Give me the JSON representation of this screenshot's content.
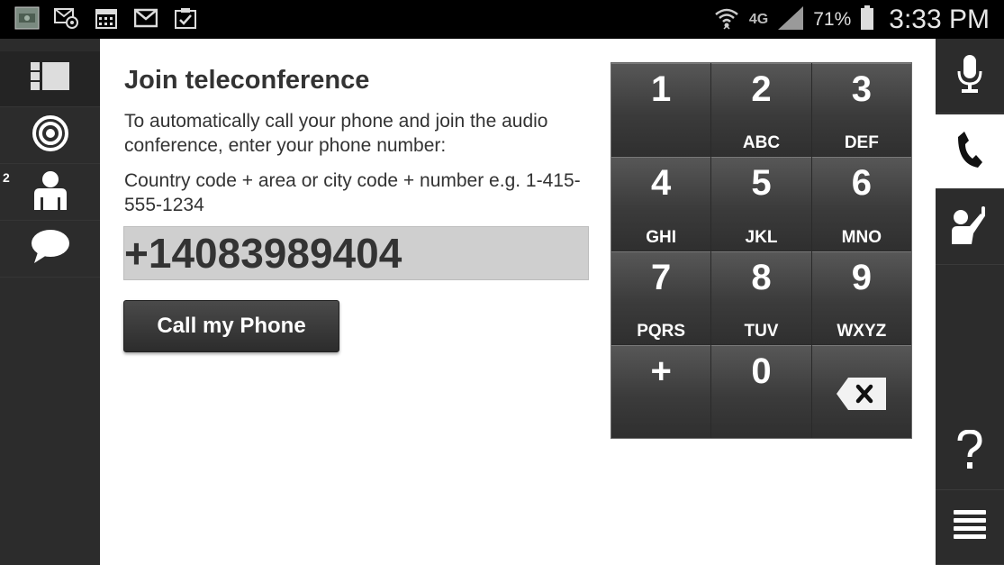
{
  "status_bar": {
    "left_icons": [
      "app-icon",
      "email-at-icon",
      "calendar-icon",
      "gmail-icon",
      "clipboard-check-icon"
    ],
    "network": "4G",
    "battery": "71%",
    "time": "3:33 PM"
  },
  "left_rail": {
    "items": [
      {
        "icon": "layout-panels-icon",
        "active": true
      },
      {
        "icon": "target-icon",
        "active": false
      },
      {
        "icon": "participant-icon",
        "badge": "2",
        "active": false
      },
      {
        "icon": "chat-bubble-icon",
        "active": false
      }
    ]
  },
  "main": {
    "title": "Join teleconference",
    "description": "To automatically call your phone and join the audio conference, enter your phone number:",
    "hint": "Country code + area or city code + number e.g. 1-415-555-1234",
    "phone_value": "+14083989404",
    "call_button": "Call my Phone"
  },
  "keypad": {
    "keys": [
      {
        "digit": "1",
        "letters": ""
      },
      {
        "digit": "2",
        "letters": "ABC"
      },
      {
        "digit": "3",
        "letters": "DEF"
      },
      {
        "digit": "4",
        "letters": "GHI"
      },
      {
        "digit": "5",
        "letters": "JKL"
      },
      {
        "digit": "6",
        "letters": "MNO"
      },
      {
        "digit": "7",
        "letters": "PQRS"
      },
      {
        "digit": "8",
        "letters": "TUV"
      },
      {
        "digit": "9",
        "letters": "WXYZ"
      },
      {
        "digit": "+",
        "letters": ""
      },
      {
        "digit": "0",
        "letters": ""
      },
      {
        "digit": "",
        "letters": "",
        "icon": "backspace-icon"
      }
    ]
  },
  "right_rail": {
    "items": [
      {
        "icon": "microphone-icon",
        "active": false
      },
      {
        "icon": "phone-icon",
        "active": true
      },
      {
        "icon": "raise-hand-icon",
        "active": false
      },
      {
        "icon": "help-icon",
        "active": false
      },
      {
        "icon": "menu-icon",
        "active": false
      }
    ]
  }
}
